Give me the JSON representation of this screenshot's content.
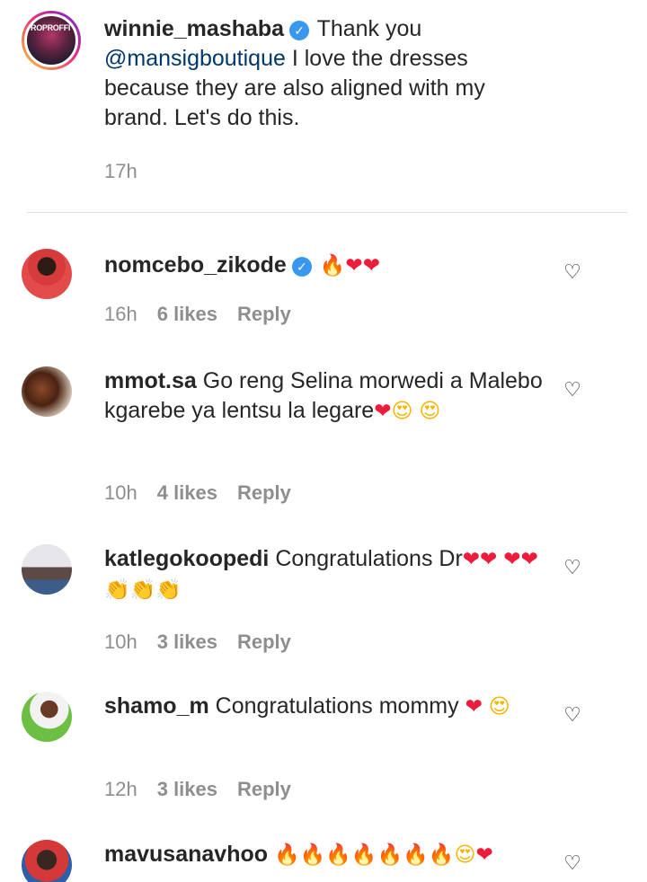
{
  "caption": {
    "username": "winnie_mashaba",
    "verified": true,
    "text_before": "Thank you",
    "mention": "@mansigboutique",
    "text_after": "I love the dresses because they are also aligned with my brand. Let's do this.",
    "time": "17h",
    "avatar_text": "ROPROFFI"
  },
  "comments": [
    {
      "username": "nomcebo_zikode",
      "verified": true,
      "text": "",
      "emojis": [
        "🔥",
        "❤",
        "❤"
      ],
      "time": "16h",
      "likes": "6 likes",
      "reply": "Reply"
    },
    {
      "username": "mmot.sa",
      "verified": false,
      "text": "Go reng Selina morwedi a Malebo kgarebe ya lentsu la legare",
      "emojis": [
        "❤",
        "😍",
        "😍"
      ],
      "time": "10h",
      "likes": "4 likes",
      "reply": "Reply"
    },
    {
      "username": "katlegokoopedi",
      "verified": false,
      "text": "Congratulations Dr",
      "emojis": [
        "❤",
        "❤",
        "❤",
        "❤",
        "👏",
        "👏",
        "👏"
      ],
      "time": "10h",
      "likes": "3 likes",
      "reply": "Reply"
    },
    {
      "username": "shamo_m",
      "verified": false,
      "text": "Congratulations mommy",
      "emojis": [
        "❤",
        "😍"
      ],
      "time": "12h",
      "likes": "3 likes",
      "reply": "Reply"
    },
    {
      "username": "mavusanavhoo",
      "verified": false,
      "text": "",
      "emojis": [
        "🔥",
        "🔥",
        "🔥",
        "🔥",
        "🔥",
        "🔥",
        "🔥",
        "😍",
        "❤"
      ],
      "time": "",
      "likes": "",
      "reply": ""
    }
  ],
  "icons": {
    "verified": "✓",
    "like": "♡"
  },
  "colors": {
    "text": "#262626",
    "meta": "#8e8e8e",
    "mention": "#00376b",
    "verified": "#3897f0",
    "heart": "#ed1c3b"
  }
}
